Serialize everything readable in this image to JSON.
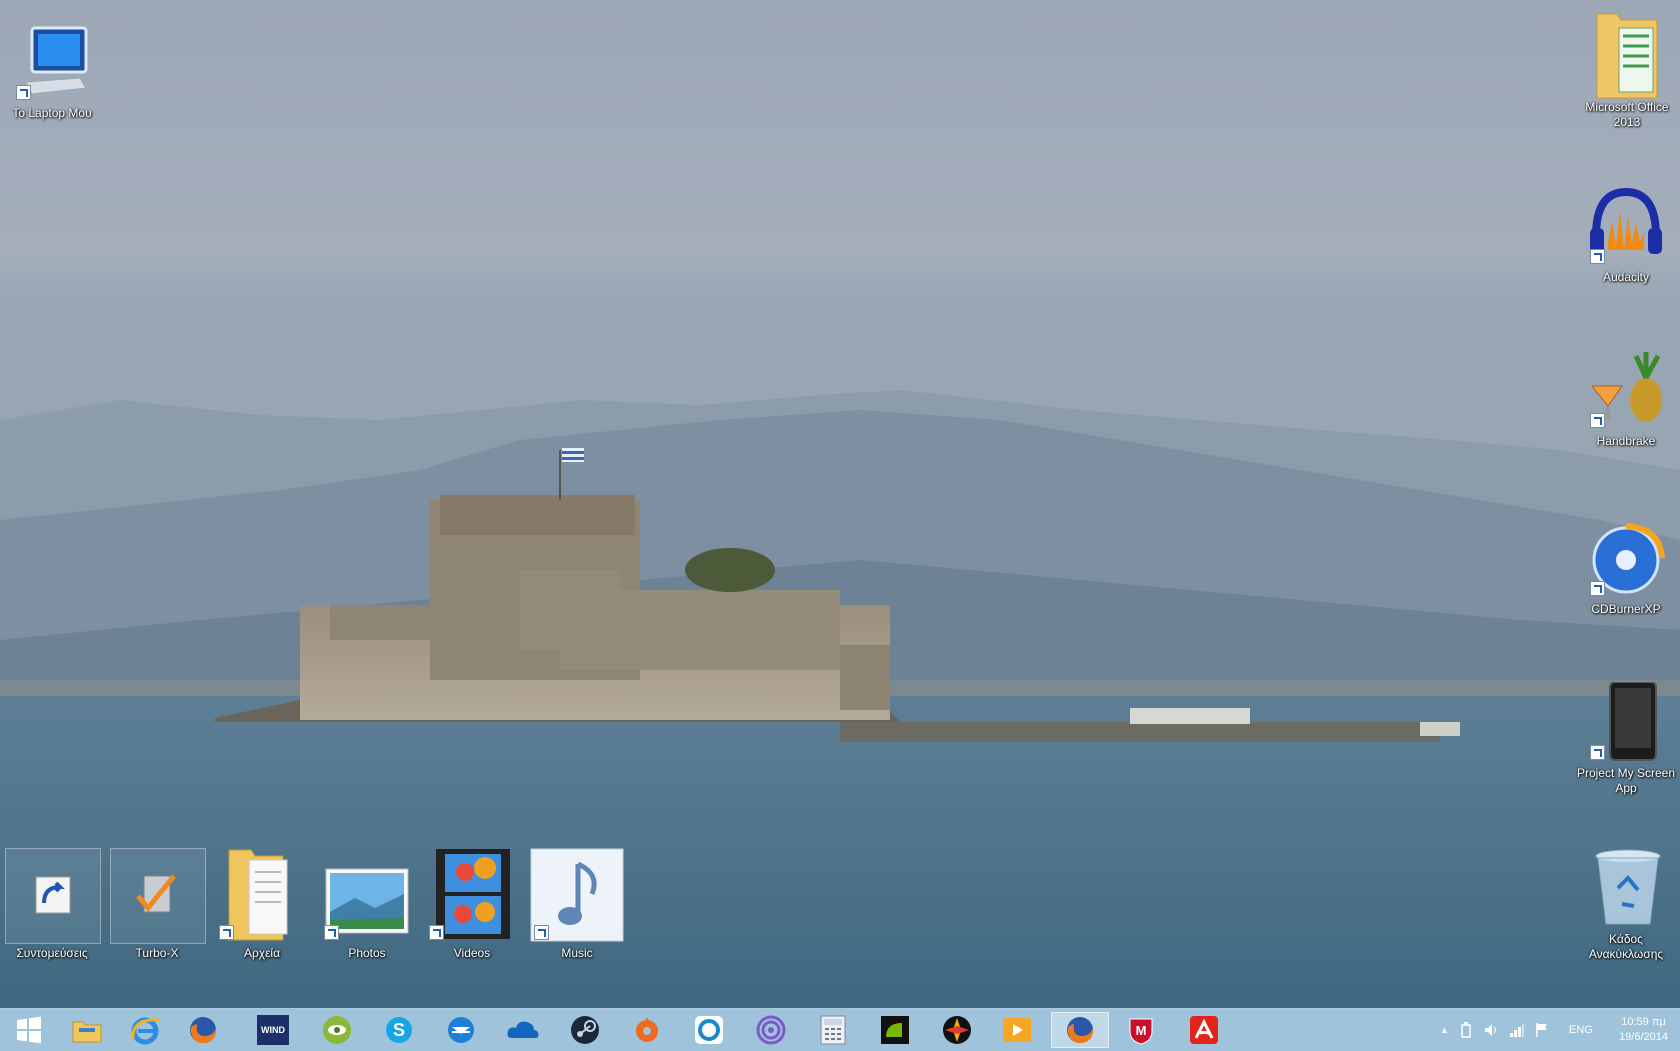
{
  "desktop": {
    "icons_left": [
      {
        "name": "computer",
        "label": "Το Laptop Μου"
      }
    ],
    "icons_right": [
      {
        "name": "office",
        "label_line1": "Microsoft Office",
        "label_line2": "2013"
      },
      {
        "name": "audacity",
        "label": "Audacity"
      },
      {
        "name": "handbrake",
        "label": "Handbrake"
      },
      {
        "name": "cdburnerxp",
        "label": "CDBurnerXP"
      },
      {
        "name": "project-my-screen",
        "label_line1": "Project My Screen",
        "label_line2": "App"
      },
      {
        "name": "recycle-bin",
        "label_line1": "Κάδος",
        "label_line2": "Ανακύκλωσης"
      }
    ],
    "icons_bottom": [
      {
        "name": "shortcuts",
        "label": "Συντομεύσεις"
      },
      {
        "name": "turbo-x",
        "label": "Turbo-X"
      },
      {
        "name": "files",
        "label": "Αρχεία"
      },
      {
        "name": "photos",
        "label": "Photos"
      },
      {
        "name": "videos",
        "label": "Videos"
      },
      {
        "name": "music",
        "label": "Music"
      }
    ]
  },
  "taskbar": {
    "items": [
      {
        "icon": "start-windows-icon"
      },
      {
        "icon": "file-explorer-icon"
      },
      {
        "icon": "internet-explorer-icon"
      },
      {
        "icon": "firefox-icon"
      },
      {
        "icon": "wind-icon",
        "text": "WIND"
      },
      {
        "icon": "eye-app-icon"
      },
      {
        "icon": "skype-icon"
      },
      {
        "icon": "mail-icon"
      },
      {
        "icon": "onedrive-icon"
      },
      {
        "icon": "steam-icon"
      },
      {
        "icon": "origin-icon"
      },
      {
        "icon": "uplay-icon"
      },
      {
        "icon": "bittorrent-icon"
      },
      {
        "icon": "calculator-icon"
      },
      {
        "icon": "nvidia-icon"
      },
      {
        "icon": "media-center-icon"
      },
      {
        "icon": "media-player-icon"
      },
      {
        "icon": "firefox-active-icon"
      },
      {
        "icon": "mcafee-icon"
      },
      {
        "icon": "avira-icon"
      }
    ],
    "tray": {
      "language": "ENG",
      "time": "10:59 πμ",
      "date": "19/6/2014"
    },
    "colors": {
      "taskbar": "#96bed7"
    }
  }
}
